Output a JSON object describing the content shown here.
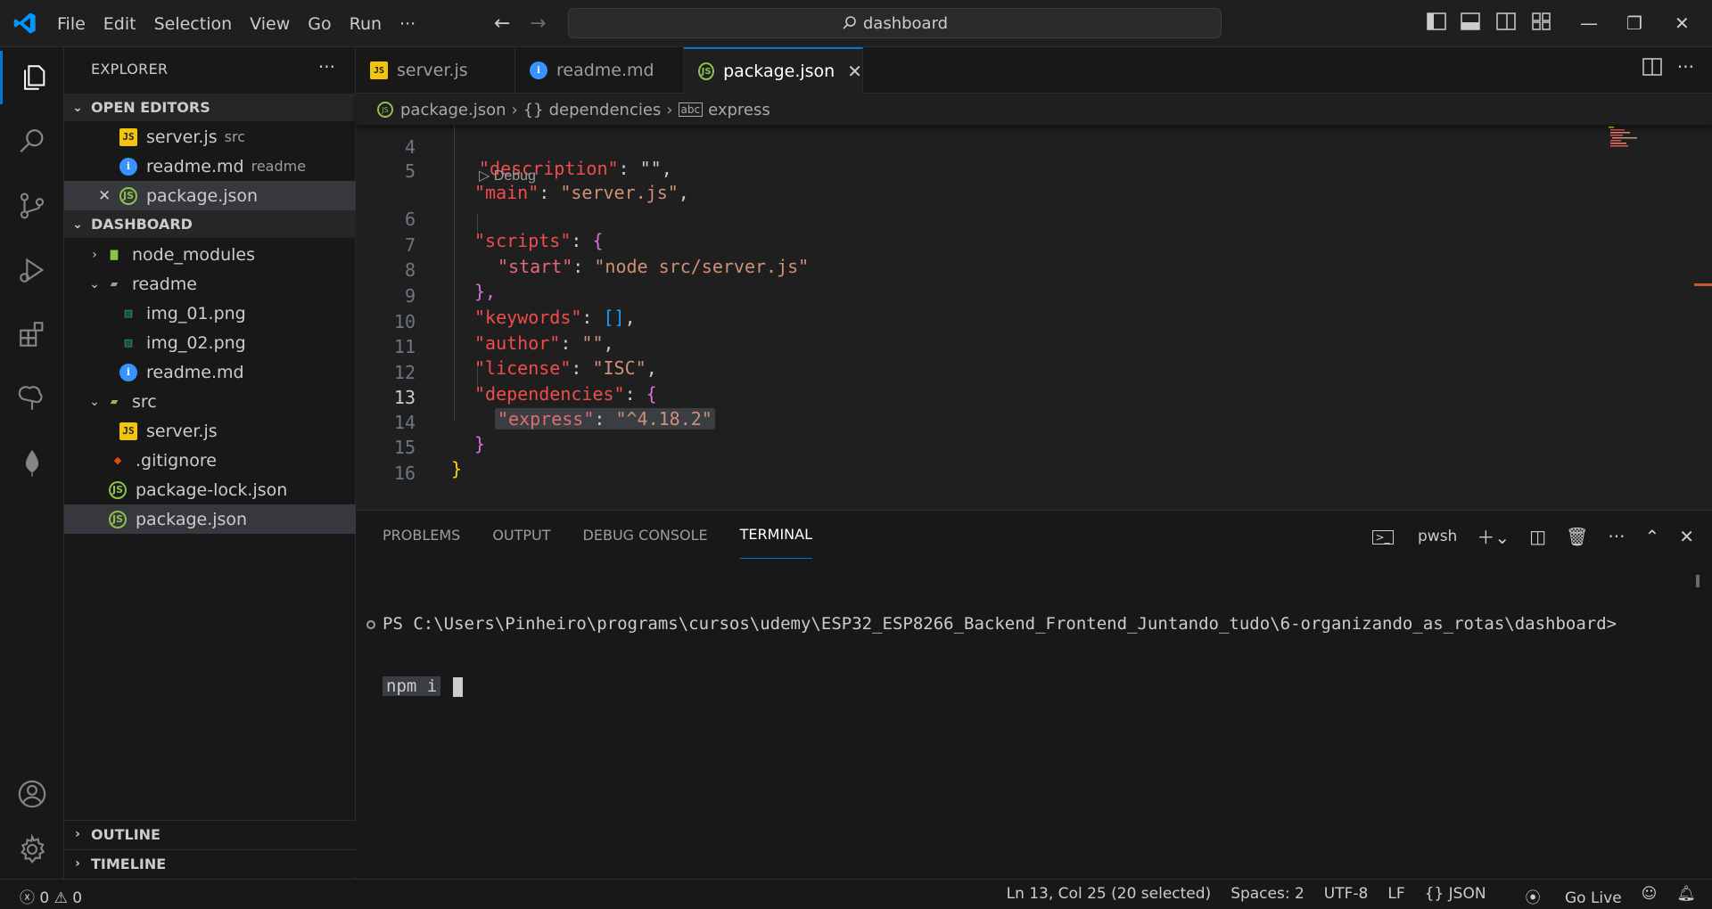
{
  "titlebar": {
    "menu": [
      "File",
      "Edit",
      "Selection",
      "View",
      "Go",
      "Run",
      "···"
    ],
    "search_text": "dashboard"
  },
  "activitybar": {
    "icons": [
      "explorer-icon",
      "search-icon",
      "source-control-icon",
      "run-debug-icon",
      "extensions-icon",
      "tree-icon",
      "mongodb-leaf-icon",
      "account-icon",
      "settings-gear-icon"
    ]
  },
  "sidebar": {
    "title": "EXPLORER",
    "open_editors_label": "OPEN EDITORS",
    "open_editors": [
      {
        "name": "server.js",
        "desc": "src"
      },
      {
        "name": "readme.md",
        "desc": "readme"
      },
      {
        "name": "package.json",
        "desc": ""
      }
    ],
    "workspace_label": "DASHBOARD",
    "tree": [
      {
        "name": "node_modules"
      },
      {
        "name": "readme"
      },
      {
        "name": "img_01.png"
      },
      {
        "name": "img_02.png"
      },
      {
        "name": "readme.md"
      },
      {
        "name": "src"
      },
      {
        "name": "server.js"
      },
      {
        "name": ".gitignore"
      },
      {
        "name": "package-lock.json"
      },
      {
        "name": "package.json"
      }
    ],
    "outline_label": "OUTLINE",
    "timeline_label": "TIMELINE"
  },
  "tabs": [
    {
      "label": "server.js"
    },
    {
      "label": "readme.md"
    },
    {
      "label": "package.json"
    }
  ],
  "breadcrumb": {
    "file": "package.json",
    "node1": "dependencies",
    "node2": "express"
  },
  "editor": {
    "line_numbers": [
      "4",
      "5",
      "6",
      "7",
      "8",
      "9",
      "10",
      "11",
      "12",
      "13",
      "14",
      "15",
      "16"
    ],
    "debug_lens": "Debug",
    "lines": {
      "l4_key": "\"description\"",
      "l4_rest": ": \"\",",
      "l5_key": "\"main\"",
      "l5_colon": ": ",
      "l5_val": "\"server.js\"",
      "l5_end": ",",
      "l6_key": "\"scripts\"",
      "l6_colon": ": ",
      "l6_brace": "{",
      "l7_key": "\"start\"",
      "l7_colon": ": ",
      "l7_val": "\"node src/server.js\"",
      "l8": "},",
      "l9_key": "\"keywords\"",
      "l9_colon": ": ",
      "l9_val": "[]",
      "l9_end": ",",
      "l10_key": "\"author\"",
      "l10_colon": ": ",
      "l10_val": "\"\"",
      "l10_end": ",",
      "l11_key": "\"license\"",
      "l11_colon": ": ",
      "l11_val": "\"ISC\"",
      "l11_end": ",",
      "l12_key": "\"dependencies\"",
      "l12_colon": ": ",
      "l12_brace": "{",
      "l13_key": "\"express\"",
      "l13_colon": ": ",
      "l13_val": "\"^4.18.2\"",
      "l14": "}",
      "l15": "}"
    }
  },
  "panel": {
    "tabs": [
      "PROBLEMS",
      "OUTPUT",
      "DEBUG CONSOLE",
      "TERMINAL"
    ],
    "shell": "pwsh",
    "terminal_prompt": "PS C:\\Users\\Pinheiro\\programs\\cursos\\udemy\\ESP32_ESP8266_Backend_Frontend_Juntando_tudo\\6-organizando_as_rotas\\dashboard>",
    "terminal_cmd": "npm i"
  },
  "statusbar": {
    "errors": "0",
    "warnings": "0",
    "position": "Ln 13, Col 25 (20 selected)",
    "spaces": "Spaces: 2",
    "encoding": "UTF-8",
    "eol": "LF",
    "language": "{} JSON",
    "golive": "Go Live"
  },
  "colors": {
    "accent": "#0078d4",
    "key": "#f14c4c",
    "string": "#ce9178",
    "background": "#1f1f1f"
  }
}
